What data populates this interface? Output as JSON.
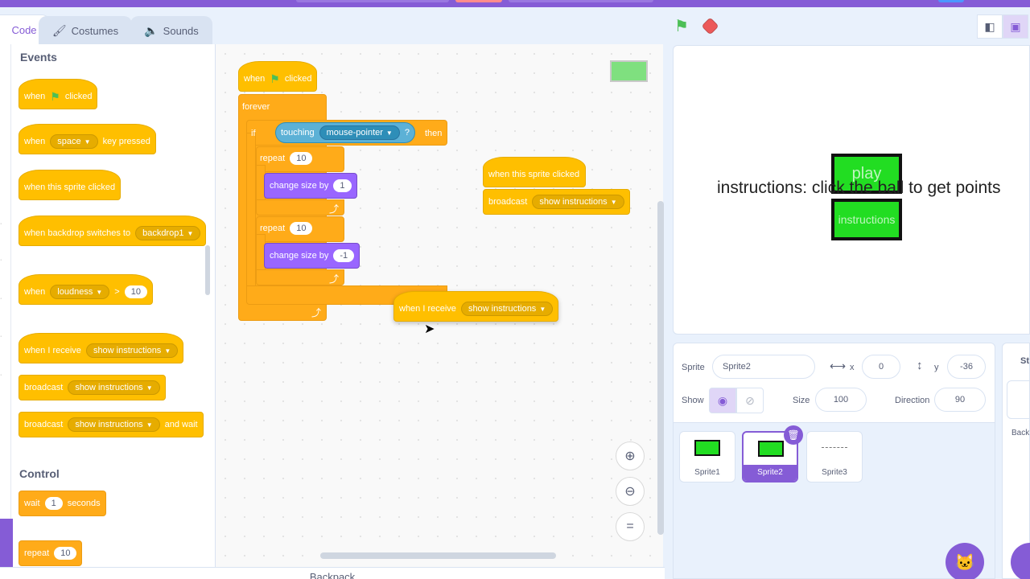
{
  "tabs": {
    "code": "Code",
    "costumes": "Costumes",
    "sounds": "Sounds"
  },
  "palette": {
    "events_title": "Events",
    "control_title": "Control",
    "when_flag": {
      "when": "when",
      "clicked": "clicked"
    },
    "when_key": {
      "when": "when",
      "key": "space",
      "pressed": "key pressed"
    },
    "when_sprite_clicked": "when this sprite clicked",
    "when_backdrop": {
      "text": "when backdrop switches to",
      "value": "backdrop1"
    },
    "when_loudness": {
      "when": "when",
      "sensor": "loudness",
      "op": ">",
      "value": "10"
    },
    "when_receive": {
      "text": "when I receive",
      "value": "show instructions"
    },
    "broadcast": {
      "text": "broadcast",
      "value": "show instructions"
    },
    "broadcast_wait": {
      "text": "broadcast",
      "value": "show instructions",
      "suffix": "and wait"
    },
    "wait": {
      "text": "wait",
      "value": "1",
      "suffix": "seconds"
    },
    "repeat": {
      "text": "repeat",
      "value": "10"
    }
  },
  "script1": {
    "when": "when",
    "clicked": "clicked",
    "forever": "forever",
    "if": "if",
    "touching": "touching",
    "target": "mouse-pointer",
    "q": "?",
    "then": "then",
    "repeat1": {
      "text": "repeat",
      "value": "10"
    },
    "change1": {
      "text": "change size by",
      "value": "1"
    },
    "repeat2": {
      "text": "repeat",
      "value": "10"
    },
    "change2": {
      "text": "change size by",
      "value": "-1"
    }
  },
  "script2": {
    "hat": "when this sprite clicked",
    "broadcast": "broadcast",
    "value": "show instructions"
  },
  "dragging": {
    "text": "when I receive",
    "value": "show instructions"
  },
  "stage": {
    "instructions_text": "instructions: click the ball to get points",
    "play_label": "play",
    "instructions_label": "instructions"
  },
  "sprite_info": {
    "sprite_label": "Sprite",
    "sprite_name": "Sprite2",
    "x_label": "x",
    "x_value": "0",
    "y_label": "y",
    "y_value": "-36",
    "show_label": "Show",
    "size_label": "Size",
    "size_value": "100",
    "direction_label": "Direction",
    "direction_value": "90"
  },
  "sprites": [
    {
      "name": "Sprite1"
    },
    {
      "name": "Sprite2"
    },
    {
      "name": "Sprite3"
    }
  ],
  "stage_pane": {
    "title": "St",
    "backdrops": "Back"
  },
  "backpack": "Backpack",
  "colors": {
    "accent": "#855cd6",
    "events": "#ffbf00",
    "control": "#ffab19",
    "looks": "#9966ff",
    "sensing": "#5cb1d6",
    "sprite_green": "#22dd22"
  }
}
